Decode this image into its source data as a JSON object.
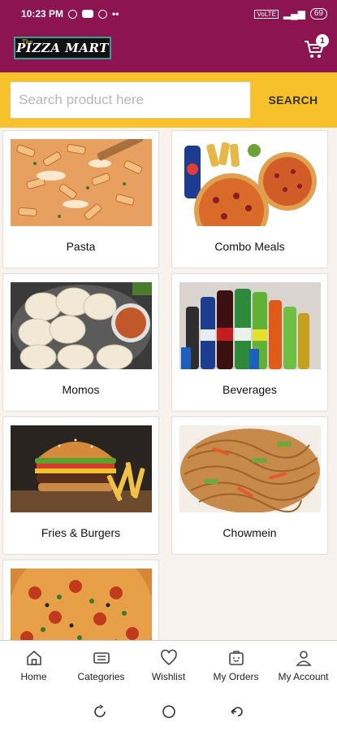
{
  "status_bar": {
    "time": "10:23 PM",
    "battery": "69",
    "network": "VoLTE"
  },
  "header": {
    "logo_the": "The",
    "logo_name": "PIZZA MART",
    "cart_count": "1"
  },
  "search": {
    "placeholder": "Search product here",
    "value": "",
    "button_label": "SEARCH"
  },
  "categories": [
    {
      "label": "Pasta",
      "image": "pasta"
    },
    {
      "label": "Combo Meals",
      "image": "combo-meals"
    },
    {
      "label": "Momos",
      "image": "momos"
    },
    {
      "label": "Beverages",
      "image": "beverages"
    },
    {
      "label": "Fries & Burgers",
      "image": "fries-burgers"
    },
    {
      "label": "Chowmein",
      "image": "chowmein"
    },
    {
      "label": "",
      "image": "pizza"
    }
  ],
  "bottom_nav": [
    {
      "label": "Home",
      "icon": "home-icon"
    },
    {
      "label": "Categories",
      "icon": "categories-icon"
    },
    {
      "label": "Wishlist",
      "icon": "heart-icon"
    },
    {
      "label": "My Orders",
      "icon": "orders-icon"
    },
    {
      "label": "My Account",
      "icon": "account-icon"
    }
  ],
  "colors": {
    "primary": "#8c1450",
    "accent": "#f7c12b",
    "grid_bg": "#f8f2ee"
  }
}
